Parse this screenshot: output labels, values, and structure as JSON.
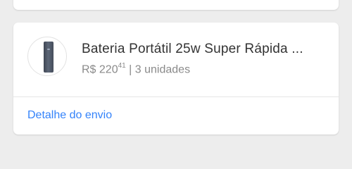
{
  "product": {
    "title": "Bateria Portátil 25w Super Rápida ...",
    "price_prefix": "R$ ",
    "price_integer": "220",
    "price_cents": "41",
    "separator": " | ",
    "quantity": "3 unidades",
    "image_icon": "powerbank-icon"
  },
  "shipping": {
    "link_label": "Detalhe do envio"
  },
  "colors": {
    "background": "#ededed",
    "card": "#ffffff",
    "link": "#3483fa",
    "title": "#333333",
    "muted": "#8a8a8a"
  }
}
